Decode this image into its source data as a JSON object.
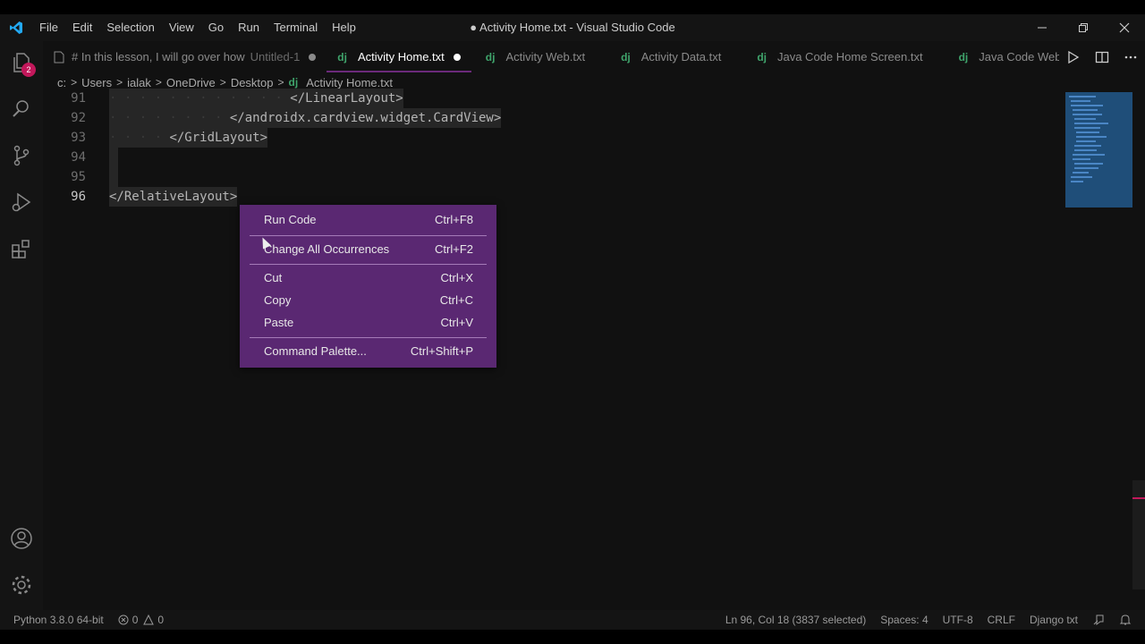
{
  "titlebar": {
    "menu": [
      "File",
      "Edit",
      "Selection",
      "View",
      "Go",
      "Run",
      "Terminal",
      "Help"
    ],
    "title": "● Activity Home.txt - Visual Studio Code"
  },
  "activitybar": {
    "badge": "2",
    "items": [
      "explorer-icon",
      "search-icon",
      "source-control-icon",
      "run-debug-icon",
      "extensions-icon",
      "accounts-icon",
      "manage-gear-icon"
    ]
  },
  "tabs": [
    {
      "label": "# In this lesson, I will go over how",
      "sub": "Untitled-1",
      "prefix": "",
      "dot_color": "#8a8a8a",
      "active": false
    },
    {
      "label": "Activity Home.txt",
      "sub": "",
      "prefix": "dj",
      "dot_color": "#ffffff",
      "active": true
    },
    {
      "label": "Activity Web.txt",
      "sub": "",
      "prefix": "dj",
      "dot_color": "",
      "active": false
    },
    {
      "label": "Activity Data.txt",
      "sub": "",
      "prefix": "dj",
      "dot_color": "",
      "active": false
    },
    {
      "label": "Java Code Home Screen.txt",
      "sub": "",
      "prefix": "dj",
      "dot_color": "",
      "active": false
    },
    {
      "label": "Java Code Web Vi",
      "sub": "",
      "prefix": "dj",
      "dot_color": "",
      "active": false
    }
  ],
  "breadcrumb": {
    "parts": [
      "c:",
      "Users",
      "ialak",
      "OneDrive",
      "Desktop"
    ],
    "file_prefix": "dj",
    "file": "Activity Home.txt"
  },
  "code": {
    "lines": [
      {
        "num": "91",
        "indent": "· · · · · · · · · · · · ",
        "text": "</LinearLayout>"
      },
      {
        "num": "92",
        "indent": "· · · · · · · · ",
        "text": "</androidx.cardview.widget.CardView>"
      },
      {
        "num": "93",
        "indent": "· · · · ",
        "text": "</GridLayout>"
      },
      {
        "num": "94",
        "indent": "",
        "text": ""
      },
      {
        "num": "95",
        "indent": "",
        "text": ""
      },
      {
        "num": "96",
        "indent": "",
        "text": "</RelativeLayout>"
      }
    ]
  },
  "context_menu": {
    "groups": [
      [
        {
          "label": "Run Code",
          "shortcut": "Ctrl+F8"
        }
      ],
      [
        {
          "label": "Change All Occurrences",
          "shortcut": "Ctrl+F2"
        }
      ],
      [
        {
          "label": "Cut",
          "shortcut": "Ctrl+X"
        },
        {
          "label": "Copy",
          "shortcut": "Ctrl+C"
        },
        {
          "label": "Paste",
          "shortcut": "Ctrl+V"
        }
      ],
      [
        {
          "label": "Command Palette...",
          "shortcut": "Ctrl+Shift+P"
        }
      ]
    ]
  },
  "statusbar": {
    "python": "Python 3.8.0 64-bit",
    "errors": "0",
    "warnings": "0",
    "position": "Ln 96, Col 18 (3837 selected)",
    "spaces": "Spaces: 4",
    "encoding": "UTF-8",
    "eol": "CRLF",
    "language": "Django txt"
  },
  "colors": {
    "accent": "#5a2872",
    "badge": "#c2185b",
    "vscode_blue": "#23a9f2"
  }
}
